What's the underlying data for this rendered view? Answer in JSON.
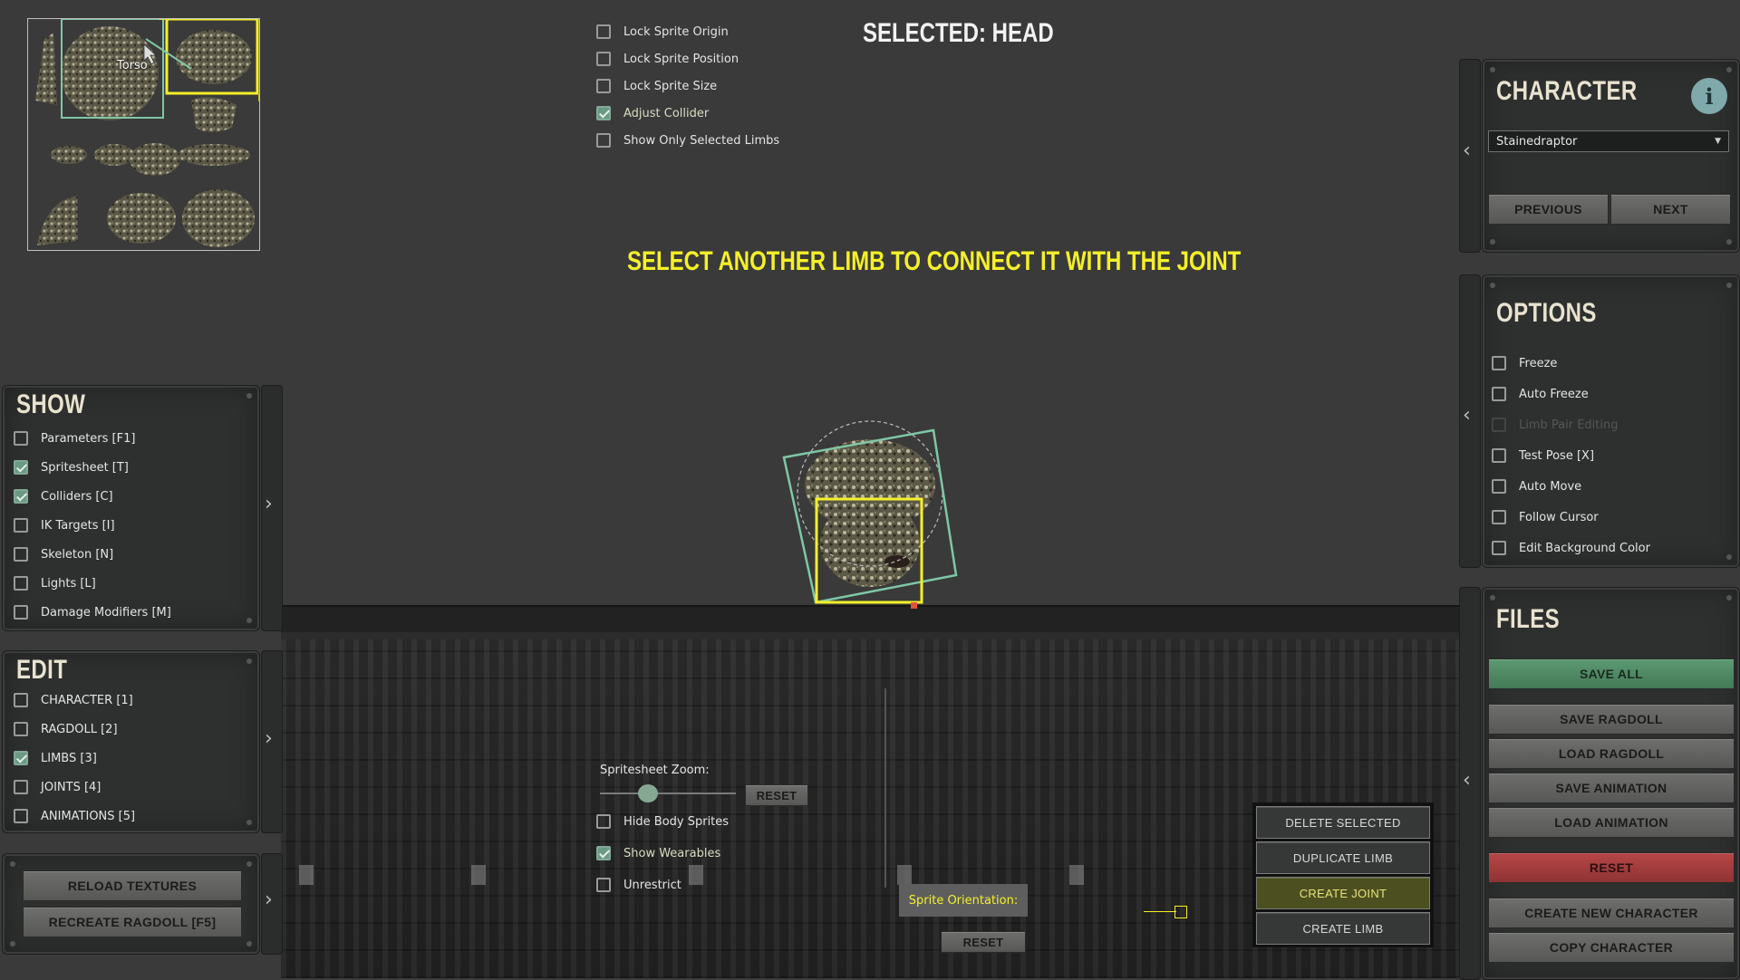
{
  "header": {
    "selected": "SELECTED: HEAD",
    "instruction": "SELECT ANOTHER LIMB TO CONNECT IT WITH THE JOINT"
  },
  "spritesheet": {
    "hover_label": "Torso"
  },
  "top_options": [
    {
      "label": "Lock Sprite Origin",
      "checked": false
    },
    {
      "label": "Lock Sprite Position",
      "checked": false
    },
    {
      "label": "Lock Sprite Size",
      "checked": false
    },
    {
      "label": "Adjust Collider",
      "checked": true
    },
    {
      "label": "Show Only Selected Limbs",
      "checked": false
    }
  ],
  "show_panel": {
    "title": "SHOW",
    "items": [
      {
        "label": "Parameters [F1]",
        "checked": false
      },
      {
        "label": "Spritesheet [T]",
        "checked": true
      },
      {
        "label": "Colliders [C]",
        "checked": true
      },
      {
        "label": "IK Targets [I]",
        "checked": false
      },
      {
        "label": "Skeleton [N]",
        "checked": false
      },
      {
        "label": "Lights [L]",
        "checked": false
      },
      {
        "label": "Damage Modifiers [M]",
        "checked": false
      }
    ]
  },
  "edit_panel": {
    "title": "EDIT",
    "items": [
      {
        "label": "CHARACTER [1]",
        "checked": false
      },
      {
        "label": "RAGDOLL [2]",
        "checked": false
      },
      {
        "label": "LIMBS [3]",
        "checked": true
      },
      {
        "label": "JOINTS [4]",
        "checked": false
      },
      {
        "label": "ANIMATIONS [5]",
        "checked": false
      }
    ]
  },
  "tools_panel": {
    "reload_textures": "RELOAD TEXTURES",
    "recreate_ragdoll": "RECREATE RAGDOLL [F5]"
  },
  "character_panel": {
    "title": "CHARACTER",
    "info_icon": "i",
    "selected_character": "Stainedraptor",
    "previous": "PREVIOUS",
    "next": "NEXT"
  },
  "options_panel": {
    "title": "OPTIONS",
    "items": [
      {
        "label": "Freeze",
        "checked": false,
        "disabled": false
      },
      {
        "label": "Auto Freeze",
        "checked": false,
        "disabled": false
      },
      {
        "label": "Limb Pair Editing",
        "checked": false,
        "disabled": true
      },
      {
        "label": "Test Pose [X]",
        "checked": false,
        "disabled": false
      },
      {
        "label": "Auto Move",
        "checked": false,
        "disabled": false
      },
      {
        "label": "Follow Cursor",
        "checked": false,
        "disabled": false
      },
      {
        "label": "Edit Background Color",
        "checked": false,
        "disabled": false
      }
    ]
  },
  "files_panel": {
    "title": "FILES",
    "save_all": "SAVE ALL",
    "save_ragdoll": "SAVE RAGDOLL",
    "load_ragdoll": "LOAD RAGDOLL",
    "save_animation": "SAVE ANIMATION",
    "load_animation": "LOAD ANIMATION",
    "reset": "RESET",
    "create_new_character": "CREATE NEW CHARACTER",
    "copy_character": "COPY CHARACTER"
  },
  "bottom_controls": {
    "zoom_label": "Spritesheet Zoom:",
    "zoom_value": 0.33,
    "zoom_reset": "RESET",
    "options": [
      {
        "label": "Hide Body Sprites",
        "checked": false
      },
      {
        "label": "Show Wearables",
        "checked": true
      },
      {
        "label": "Unrestrict",
        "checked": false
      }
    ],
    "orientation_label": "Sprite Orientation:",
    "orientation_reset": "RESET"
  },
  "limb_actions": {
    "delete_selected": "DELETE SELECTED",
    "duplicate_limb": "DUPLICATE LIMB",
    "create_joint": "CREATE JOINT",
    "create_limb": "CREATE LIMB"
  },
  "colors": {
    "accent_yellow": "#f4f02a",
    "collider_green": "#7fc7a6",
    "save_green": "#4f8d63",
    "reset_red": "#a83c3d"
  }
}
